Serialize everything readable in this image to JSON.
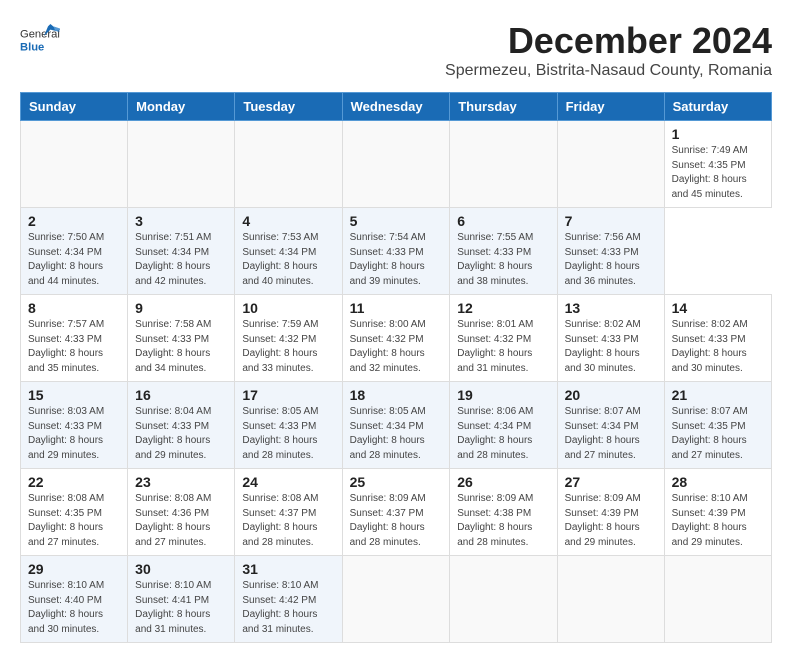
{
  "header": {
    "logo_general": "General",
    "logo_blue": "Blue",
    "title": "December 2024",
    "subtitle": "Spermezeu, Bistrita-Nasaud County, Romania"
  },
  "calendar": {
    "days_of_week": [
      "Sunday",
      "Monday",
      "Tuesday",
      "Wednesday",
      "Thursday",
      "Friday",
      "Saturday"
    ],
    "weeks": [
      [
        null,
        null,
        null,
        null,
        null,
        null,
        {
          "day": "1",
          "sunrise": "Sunrise: 7:49 AM",
          "sunset": "Sunset: 4:35 PM",
          "daylight": "Daylight: 8 hours and 45 minutes."
        }
      ],
      [
        {
          "day": "2",
          "sunrise": "Sunrise: 7:50 AM",
          "sunset": "Sunset: 4:34 PM",
          "daylight": "Daylight: 8 hours and 44 minutes."
        },
        {
          "day": "3",
          "sunrise": "Sunrise: 7:51 AM",
          "sunset": "Sunset: 4:34 PM",
          "daylight": "Daylight: 8 hours and 42 minutes."
        },
        {
          "day": "4",
          "sunrise": "Sunrise: 7:53 AM",
          "sunset": "Sunset: 4:34 PM",
          "daylight": "Daylight: 8 hours and 40 minutes."
        },
        {
          "day": "5",
          "sunrise": "Sunrise: 7:54 AM",
          "sunset": "Sunset: 4:33 PM",
          "daylight": "Daylight: 8 hours and 39 minutes."
        },
        {
          "day": "6",
          "sunrise": "Sunrise: 7:55 AM",
          "sunset": "Sunset: 4:33 PM",
          "daylight": "Daylight: 8 hours and 38 minutes."
        },
        {
          "day": "7",
          "sunrise": "Sunrise: 7:56 AM",
          "sunset": "Sunset: 4:33 PM",
          "daylight": "Daylight: 8 hours and 36 minutes."
        }
      ],
      [
        {
          "day": "8",
          "sunrise": "Sunrise: 7:57 AM",
          "sunset": "Sunset: 4:33 PM",
          "daylight": "Daylight: 8 hours and 35 minutes."
        },
        {
          "day": "9",
          "sunrise": "Sunrise: 7:58 AM",
          "sunset": "Sunset: 4:33 PM",
          "daylight": "Daylight: 8 hours and 34 minutes."
        },
        {
          "day": "10",
          "sunrise": "Sunrise: 7:59 AM",
          "sunset": "Sunset: 4:32 PM",
          "daylight": "Daylight: 8 hours and 33 minutes."
        },
        {
          "day": "11",
          "sunrise": "Sunrise: 8:00 AM",
          "sunset": "Sunset: 4:32 PM",
          "daylight": "Daylight: 8 hours and 32 minutes."
        },
        {
          "day": "12",
          "sunrise": "Sunrise: 8:01 AM",
          "sunset": "Sunset: 4:32 PM",
          "daylight": "Daylight: 8 hours and 31 minutes."
        },
        {
          "day": "13",
          "sunrise": "Sunrise: 8:02 AM",
          "sunset": "Sunset: 4:33 PM",
          "daylight": "Daylight: 8 hours and 30 minutes."
        },
        {
          "day": "14",
          "sunrise": "Sunrise: 8:02 AM",
          "sunset": "Sunset: 4:33 PM",
          "daylight": "Daylight: 8 hours and 30 minutes."
        }
      ],
      [
        {
          "day": "15",
          "sunrise": "Sunrise: 8:03 AM",
          "sunset": "Sunset: 4:33 PM",
          "daylight": "Daylight: 8 hours and 29 minutes."
        },
        {
          "day": "16",
          "sunrise": "Sunrise: 8:04 AM",
          "sunset": "Sunset: 4:33 PM",
          "daylight": "Daylight: 8 hours and 29 minutes."
        },
        {
          "day": "17",
          "sunrise": "Sunrise: 8:05 AM",
          "sunset": "Sunset: 4:33 PM",
          "daylight": "Daylight: 8 hours and 28 minutes."
        },
        {
          "day": "18",
          "sunrise": "Sunrise: 8:05 AM",
          "sunset": "Sunset: 4:34 PM",
          "daylight": "Daylight: 8 hours and 28 minutes."
        },
        {
          "day": "19",
          "sunrise": "Sunrise: 8:06 AM",
          "sunset": "Sunset: 4:34 PM",
          "daylight": "Daylight: 8 hours and 28 minutes."
        },
        {
          "day": "20",
          "sunrise": "Sunrise: 8:07 AM",
          "sunset": "Sunset: 4:34 PM",
          "daylight": "Daylight: 8 hours and 27 minutes."
        },
        {
          "day": "21",
          "sunrise": "Sunrise: 8:07 AM",
          "sunset": "Sunset: 4:35 PM",
          "daylight": "Daylight: 8 hours and 27 minutes."
        }
      ],
      [
        {
          "day": "22",
          "sunrise": "Sunrise: 8:08 AM",
          "sunset": "Sunset: 4:35 PM",
          "daylight": "Daylight: 8 hours and 27 minutes."
        },
        {
          "day": "23",
          "sunrise": "Sunrise: 8:08 AM",
          "sunset": "Sunset: 4:36 PM",
          "daylight": "Daylight: 8 hours and 27 minutes."
        },
        {
          "day": "24",
          "sunrise": "Sunrise: 8:08 AM",
          "sunset": "Sunset: 4:37 PM",
          "daylight": "Daylight: 8 hours and 28 minutes."
        },
        {
          "day": "25",
          "sunrise": "Sunrise: 8:09 AM",
          "sunset": "Sunset: 4:37 PM",
          "daylight": "Daylight: 8 hours and 28 minutes."
        },
        {
          "day": "26",
          "sunrise": "Sunrise: 8:09 AM",
          "sunset": "Sunset: 4:38 PM",
          "daylight": "Daylight: 8 hours and 28 minutes."
        },
        {
          "day": "27",
          "sunrise": "Sunrise: 8:09 AM",
          "sunset": "Sunset: 4:39 PM",
          "daylight": "Daylight: 8 hours and 29 minutes."
        },
        {
          "day": "28",
          "sunrise": "Sunrise: 8:10 AM",
          "sunset": "Sunset: 4:39 PM",
          "daylight": "Daylight: 8 hours and 29 minutes."
        }
      ],
      [
        {
          "day": "29",
          "sunrise": "Sunrise: 8:10 AM",
          "sunset": "Sunset: 4:40 PM",
          "daylight": "Daylight: 8 hours and 30 minutes."
        },
        {
          "day": "30",
          "sunrise": "Sunrise: 8:10 AM",
          "sunset": "Sunset: 4:41 PM",
          "daylight": "Daylight: 8 hours and 31 minutes."
        },
        {
          "day": "31",
          "sunrise": "Sunrise: 8:10 AM",
          "sunset": "Sunset: 4:42 PM",
          "daylight": "Daylight: 8 hours and 31 minutes."
        },
        null,
        null,
        null,
        null
      ]
    ]
  }
}
